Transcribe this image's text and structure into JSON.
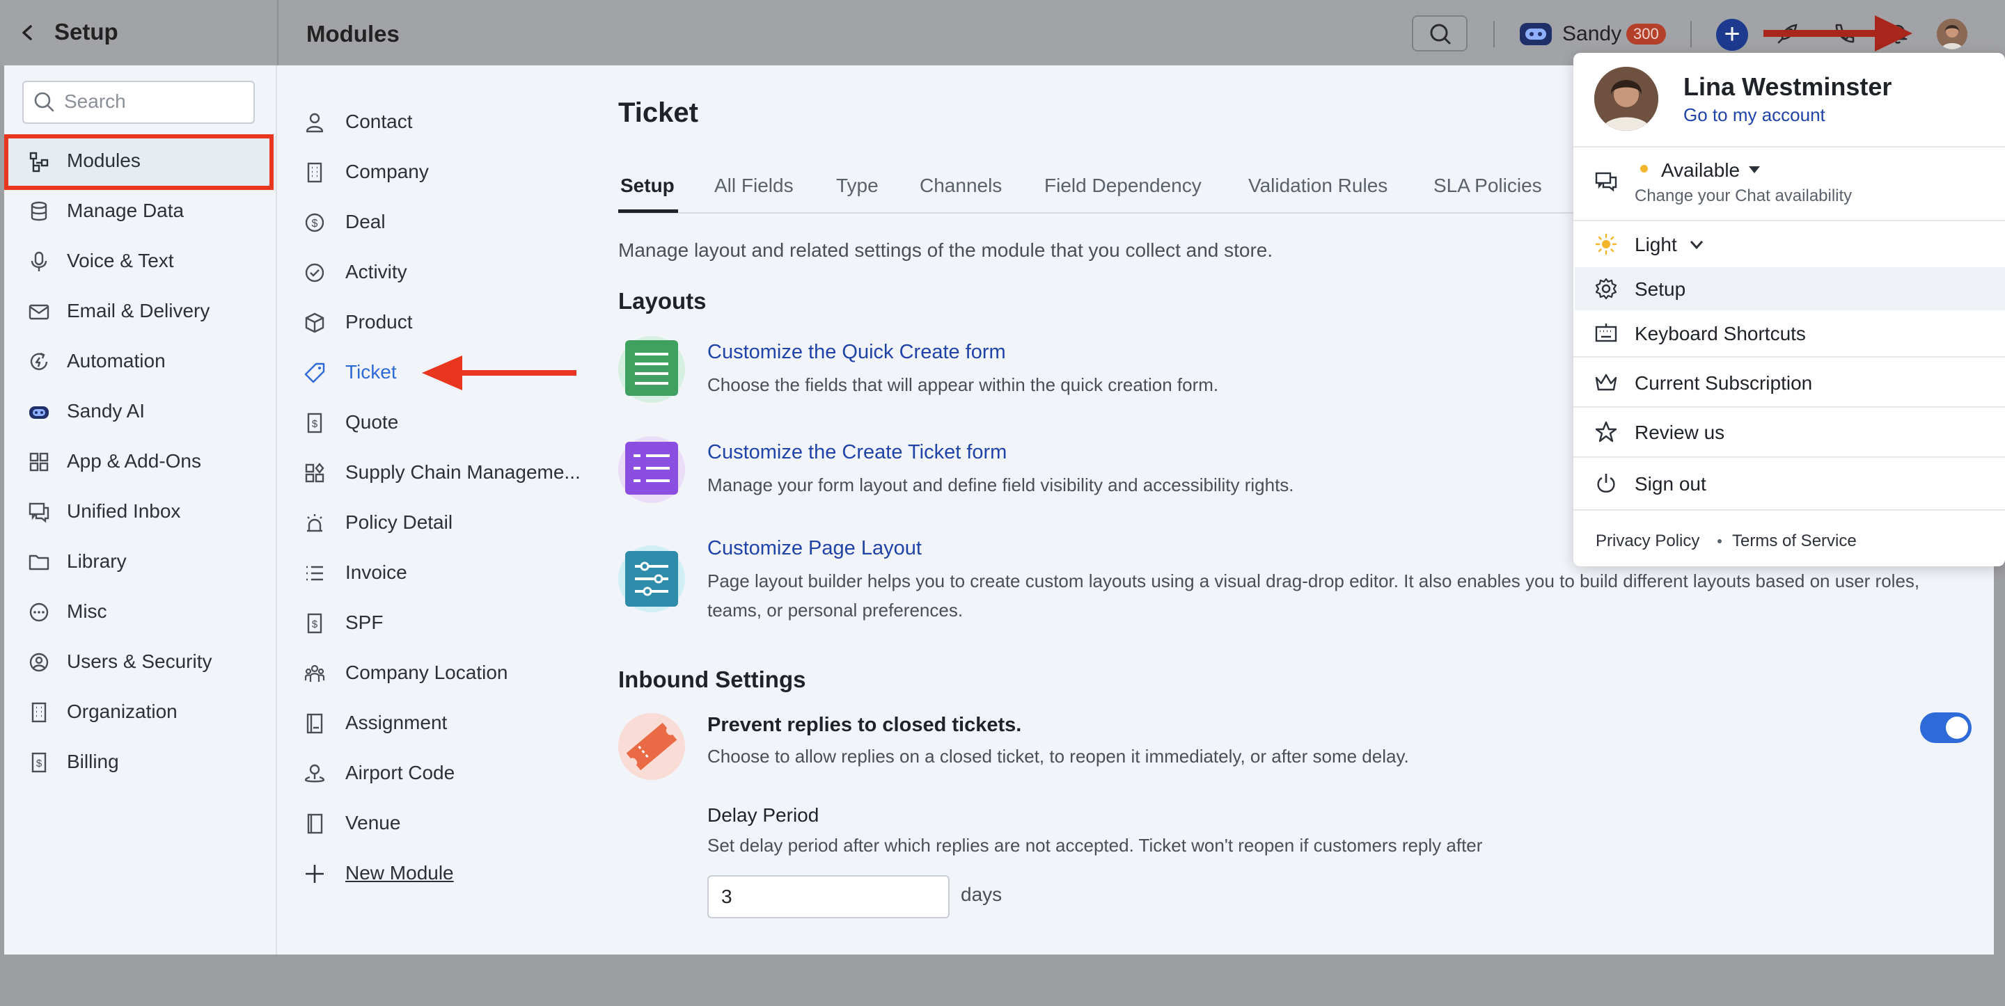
{
  "header": {
    "back_label": "Setup",
    "section_title": "Modules",
    "assistant_name": "Sandy",
    "assistant_badge": "300"
  },
  "sidebar": {
    "search_placeholder": "Search",
    "items": [
      {
        "label": "Modules",
        "icon": "modules-icon"
      },
      {
        "label": "Manage Data",
        "icon": "database-icon"
      },
      {
        "label": "Voice & Text",
        "icon": "microphone-icon"
      },
      {
        "label": "Email & Delivery",
        "icon": "envelope-icon"
      },
      {
        "label": "Automation",
        "icon": "automation-icon"
      },
      {
        "label": "Sandy AI",
        "icon": "sandy-ai-icon"
      },
      {
        "label": "App & Add-Ons",
        "icon": "apps-grid-icon"
      },
      {
        "label": "Unified Inbox",
        "icon": "inbox-chat-icon"
      },
      {
        "label": "Library",
        "icon": "folder-icon"
      },
      {
        "label": "Misc",
        "icon": "more-circle-icon"
      },
      {
        "label": "Users & Security",
        "icon": "user-circle-icon"
      },
      {
        "label": "Organization",
        "icon": "building-icon"
      },
      {
        "label": "Billing",
        "icon": "billing-icon"
      }
    ]
  },
  "modules": {
    "items": [
      {
        "label": "Contact",
        "icon": "person-icon"
      },
      {
        "label": "Company",
        "icon": "building-icon"
      },
      {
        "label": "Deal",
        "icon": "dollar-circle-icon"
      },
      {
        "label": "Activity",
        "icon": "check-circle-icon"
      },
      {
        "label": "Product",
        "icon": "box-icon"
      },
      {
        "label": "Ticket",
        "icon": "ticket-icon"
      },
      {
        "label": "Quote",
        "icon": "quote-doc-icon"
      },
      {
        "label": "Supply Chain Manageme...",
        "icon": "shapes-icon"
      },
      {
        "label": "Policy Detail",
        "icon": "alarm-icon"
      },
      {
        "label": "Invoice",
        "icon": "list-icon"
      },
      {
        "label": "SPF",
        "icon": "dollar-doc-icon"
      },
      {
        "label": "Company Location",
        "icon": "people-group-icon"
      },
      {
        "label": "Assignment",
        "icon": "notebook-icon"
      },
      {
        "label": "Airport Code",
        "icon": "location-person-icon"
      },
      {
        "label": "Venue",
        "icon": "book-icon"
      }
    ],
    "new_module_label": "New Module"
  },
  "content": {
    "title": "Ticket",
    "tabs": [
      "Setup",
      "All Fields",
      "Type",
      "Channels",
      "Field Dependency",
      "Validation Rules",
      "SLA Policies"
    ],
    "description": "Manage layout and related settings of the module that you collect and store.",
    "layouts_heading": "Layouts",
    "layout_options": [
      {
        "title": "Customize the Quick Create form",
        "desc": "Choose the fields that will appear within the quick creation form."
      },
      {
        "title": "Customize the Create Ticket form",
        "desc": "Manage your form layout and define field visibility and accessibility rights."
      },
      {
        "title": "Customize Page Layout",
        "desc": "Page layout builder helps you to create custom layouts using a visual drag-drop editor. It also enables you to build different layouts based on user roles, teams, or personal preferences."
      }
    ],
    "inbound_heading": "Inbound Settings",
    "prevent_title": "Prevent replies to closed tickets.",
    "prevent_desc": "Choose to allow replies on a closed ticket, to reopen it immediately, or after some delay.",
    "prevent_enabled": true,
    "delay_title": "Delay Period",
    "delay_desc": "Set delay period after which replies are not accepted. Ticket won't reopen if customers reply after",
    "delay_value": "3",
    "delay_unit": "days"
  },
  "profile_menu": {
    "name": "Lina Westminster",
    "account_link": "Go to my account",
    "status": "Available",
    "status_sub": "Change your Chat availability",
    "theme": "Light",
    "items": [
      "Setup",
      "Keyboard Shortcuts",
      "Current Subscription",
      "Review us",
      "Sign out"
    ],
    "privacy": "Privacy Policy",
    "terms": "Terms of Service"
  },
  "colors": {
    "accent": "#2f6ad9",
    "annotation_red": "#e8361f",
    "link_blue": "#2043a8"
  }
}
